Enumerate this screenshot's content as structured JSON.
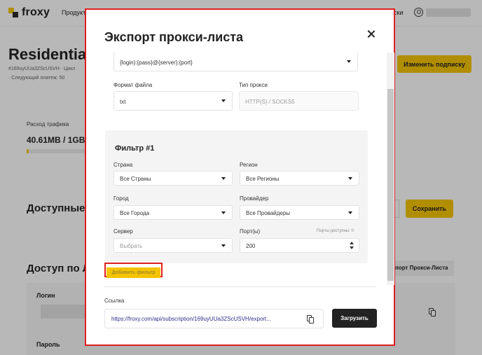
{
  "background": {
    "brand": "froxy",
    "nav_product": "Продукт",
    "nav_right": "ски",
    "page_title": "Residentia",
    "subscription_id": "#169uyUUa3ZScUSVH  ·  Цикл",
    "next_payment": "·  Следующий платеж: 50",
    "change_subscription_label": "Изменить подписку",
    "traffic_label": "Расход трафика",
    "traffic_value": "40.61MB / 1GB",
    "traffic_used_fraction": 0.04,
    "available_heading": "Доступные I",
    "save_label": "Сохранить",
    "access_heading": "Доступ по Ло",
    "export_tab_label": "порт Прокси-Листа",
    "login_label": "Логин",
    "password_label": "Пароль"
  },
  "modal": {
    "title": "Экспорт прокси-листа",
    "template_value": "{login}:{pass}@{server}:{port}",
    "file_format_label": "Формат файла",
    "file_format_value": "txt",
    "proxy_type_label": "Тип прокси",
    "proxy_type_placeholder": "HTTP(S) / SOCKS5",
    "filter": {
      "title": "Фильтр #1",
      "country_label": "Страна",
      "country_value": "Все Страны",
      "region_label": "Регион",
      "region_value": "Все Регионы",
      "city_label": "Город",
      "city_value": "Все Города",
      "provider_label": "Провайдер",
      "provider_value": "Все Провайдеры",
      "server_label": "Сервер",
      "server_placeholder": "Выбрать",
      "ports_label": "Порт(ы)",
      "ports_hint": "Порты доступны: 0",
      "ports_value": "200"
    },
    "add_filter_label": "Добавить фильтр",
    "link_label": "Ссылка",
    "link_value": "https://froxy.com/api/subscription/169uyUUa3ZScUSVH/export...",
    "load_label": "Загрузить"
  },
  "colors": {
    "accent": "#f5c400",
    "highlight_border": "#e02020",
    "link": "#2f2f8a",
    "dark_button": "#222222"
  }
}
